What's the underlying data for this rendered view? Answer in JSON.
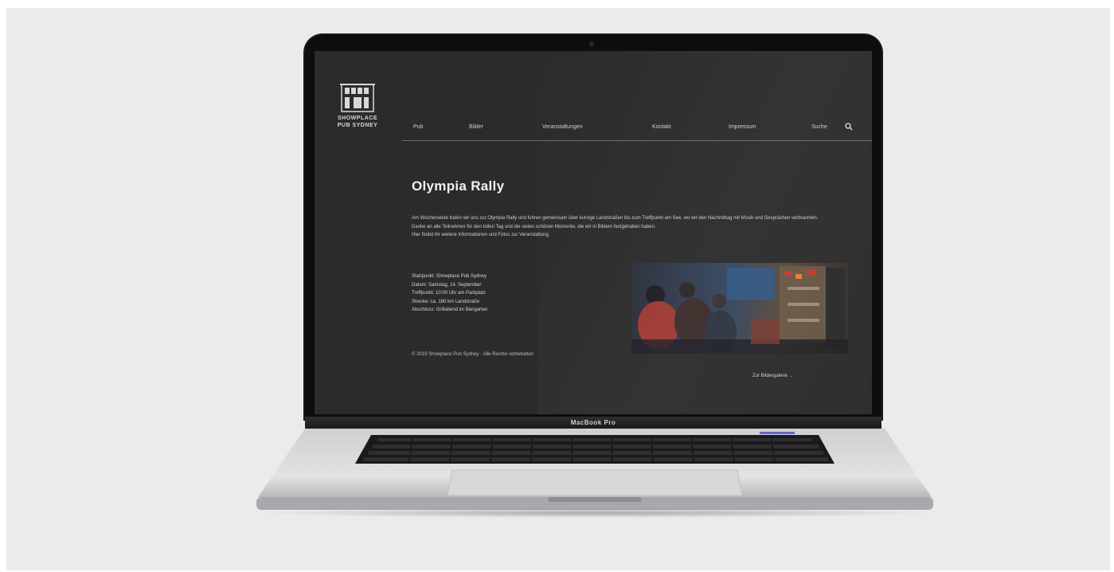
{
  "site": {
    "logo_name": "SHOWPLACE PUB SYDNEY",
    "nav": [
      {
        "label": "Pub"
      },
      {
        "label": "Bilder"
      },
      {
        "label": "Veranstaltungen"
      },
      {
        "label": "Kontakt"
      },
      {
        "label": "Impressum"
      },
      {
        "label": "Suche"
      }
    ],
    "search_icon": "search-icon"
  },
  "page": {
    "title": "Olympia Rally",
    "intro": [
      "Am Wochenende trafen wir uns zur Olympia Rally und fuhren gemeinsam über kurvige Landstraßen bis zum Treffpunkt am See, wo wir den Nachmittag mit Musik und Gesprächen verbrachten.",
      "Danke an alle Teilnehmer für den tollen Tag und die vielen schönen Momente, die wir in Bildern festgehalten haben.",
      "Hier findet ihr weitere Informationen und Fotos zur Veranstaltung."
    ],
    "details": [
      "Startpunkt: Showplace Pub Sydney",
      "Datum: Samstag, 14. September",
      "Treffpunkt: 10:00 Uhr am Parkplatz",
      "Strecke: ca. 180 km Landstraße",
      "Abschluss: Grillabend im Biergarten"
    ],
    "copyright": "© 2019 Showplace Pub Sydney · Alle Rechte vorbehalten",
    "photo_alt": "event-photo",
    "photo_link": "Zur Bildergalerie →"
  },
  "device": {
    "brand": "MacBook Pro"
  },
  "colors": {
    "screen_bg": "#2b2b2b",
    "title": "#f2f2f2",
    "text": "#cfcfcf",
    "backdrop": "#ebebeb"
  }
}
